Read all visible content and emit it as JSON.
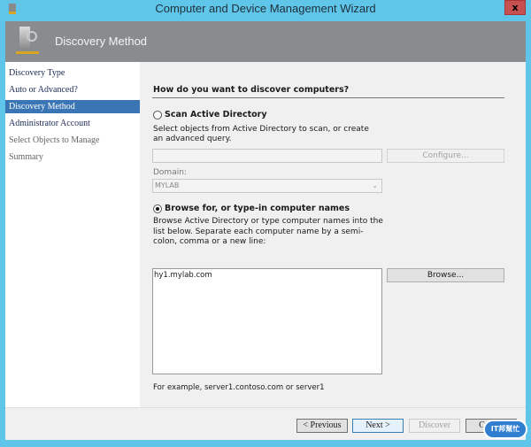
{
  "window": {
    "title": "Computer and Device Management Wizard",
    "close_label": "x"
  },
  "header": {
    "title": "Discovery Method"
  },
  "nav": {
    "items": [
      {
        "label": "Discovery Type",
        "state": "done"
      },
      {
        "label": "Auto or Advanced?",
        "state": "done"
      },
      {
        "label": "Discovery Method",
        "state": "selected"
      },
      {
        "label": "Administrator Account",
        "state": "done"
      },
      {
        "label": "Select Objects to Manage",
        "state": "pending"
      },
      {
        "label": "Summary",
        "state": "pending"
      }
    ]
  },
  "main": {
    "question": "How do you want to discover computers?",
    "scan": {
      "label": "Scan Active Directory",
      "selected": false,
      "description": "Select objects from Active Directory to scan, or create an advanced query.",
      "query_value": "",
      "configure_label": "Configure...",
      "domain_label": "Domain:",
      "domain_value": "MYLAB"
    },
    "browse": {
      "label": "Browse for, or type-in computer names",
      "selected": true,
      "description": "Browse Active Directory or type computer names into the list below. Separate each computer name by a semi-colon, comma or a new line:",
      "names_value": "hy1.mylab.com",
      "browse_label": "Browse...",
      "example": "For example, server1.contoso.com or server1"
    }
  },
  "footer": {
    "previous": "< Previous",
    "next": "Next >",
    "discover": "Discover",
    "cancel": "Cancel"
  },
  "watermark": {
    "text": "IT邦幫忙"
  },
  "colors": {
    "titlebar": "#5fc6e9",
    "header": "#898c8f",
    "nav_selected": "#3a76b5",
    "close": "#c75050"
  }
}
